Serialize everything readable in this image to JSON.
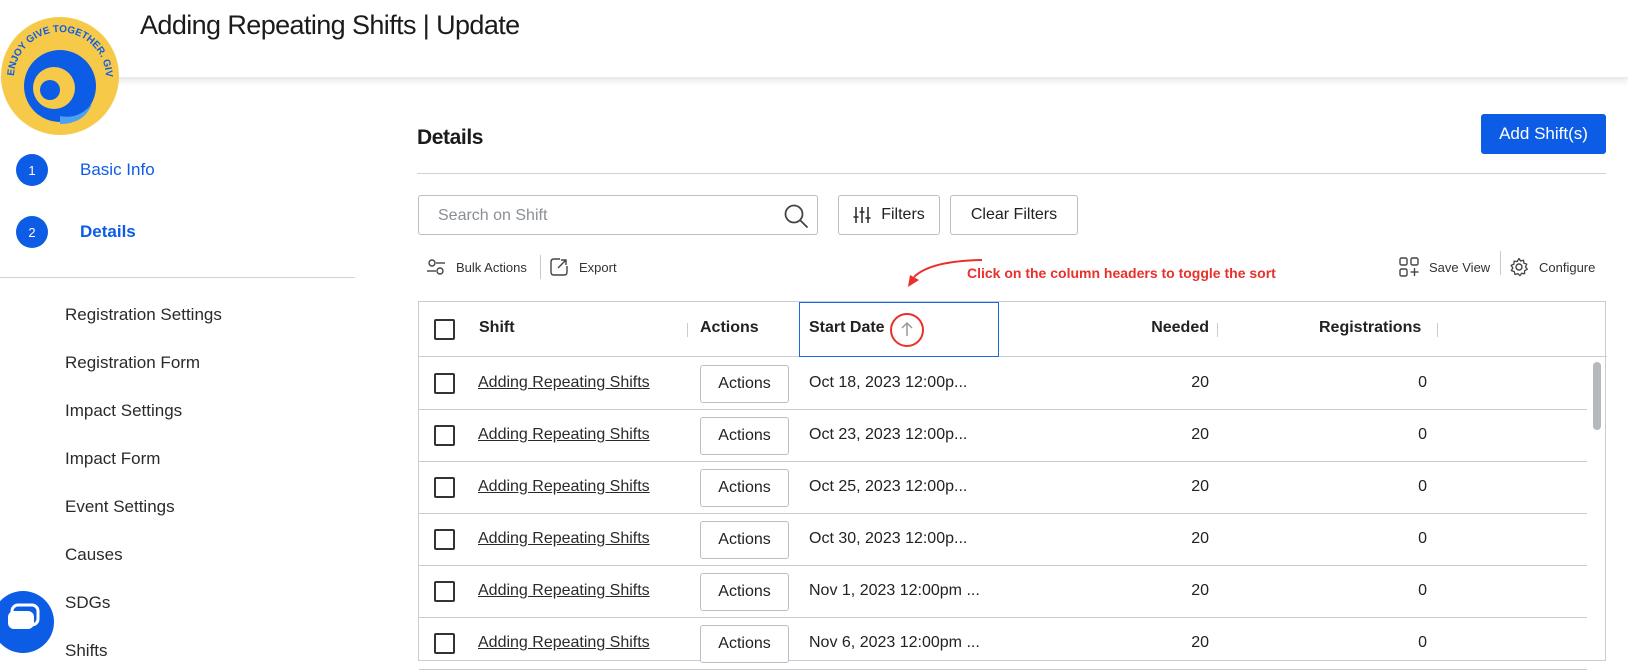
{
  "header": {
    "title": "Adding Repeating Shifts | Update",
    "logo_text": "ENJOY GIVE TOGETHER. GIVE"
  },
  "steps": [
    {
      "number": "1",
      "label": "Basic Info"
    },
    {
      "number": "2",
      "label": "Details"
    }
  ],
  "sidebar": {
    "items": [
      {
        "label": "Registration Settings"
      },
      {
        "label": "Registration Form"
      },
      {
        "label": "Impact Settings"
      },
      {
        "label": "Impact Form"
      },
      {
        "label": "Event Settings"
      },
      {
        "label": "Causes"
      },
      {
        "label": "SDGs"
      },
      {
        "label": "Shifts"
      }
    ]
  },
  "main": {
    "title": "Details",
    "add_button": "Add Shift(s)",
    "search": {
      "placeholder": "Search on Shift",
      "value": ""
    },
    "filters_label": "Filters",
    "clear_filters_label": "Clear Filters",
    "bulk_actions_label": "Bulk Actions",
    "export_label": "Export",
    "save_view_label": "Save View",
    "configure_label": "Configure",
    "annotation": "Click on the column headers to toggle the sort"
  },
  "table": {
    "columns": [
      "Shift",
      "Actions",
      "Start Date",
      "Needed",
      "Registrations"
    ],
    "sorted_column": "Start Date",
    "sort_direction": "ascending",
    "rows": [
      {
        "shift": "Adding Repeating Shifts",
        "action": "Actions",
        "start": "Oct 18, 2023 12:00p...",
        "needed": "20",
        "registrations": "0"
      },
      {
        "shift": "Adding Repeating Shifts",
        "action": "Actions",
        "start": "Oct 23, 2023 12:00p...",
        "needed": "20",
        "registrations": "0"
      },
      {
        "shift": "Adding Repeating Shifts",
        "action": "Actions",
        "start": "Oct 25, 2023 12:00p...",
        "needed": "20",
        "registrations": "0"
      },
      {
        "shift": "Adding Repeating Shifts",
        "action": "Actions",
        "start": "Oct 30, 2023 12:00p...",
        "needed": "20",
        "registrations": "0"
      },
      {
        "shift": "Adding Repeating Shifts",
        "action": "Actions",
        "start": "Nov 1, 2023 12:00pm ...",
        "needed": "20",
        "registrations": "0"
      },
      {
        "shift": "Adding Repeating Shifts",
        "action": "Actions",
        "start": "Nov 6, 2023 12:00pm ...",
        "needed": "20",
        "registrations": "0"
      }
    ]
  },
  "colors": {
    "accent": "#0d5ce6",
    "annotation": "#e8302c",
    "logo_yellow": "#f7c948",
    "logo_blue": "#0d5ce6"
  }
}
